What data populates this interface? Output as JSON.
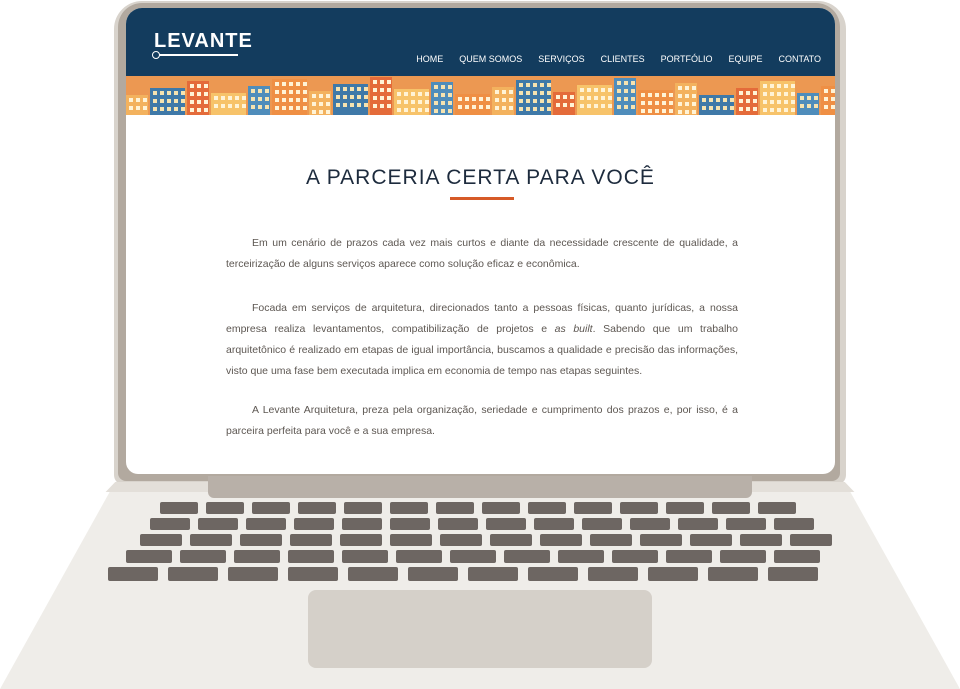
{
  "site": {
    "logo_text": "LEVANTE",
    "nav": [
      "HOME",
      "QUEM SOMOS",
      "SERVIÇOS",
      "CLIENTES",
      "PORTFÓLIO",
      "EQUIPE",
      "CONTATO"
    ]
  },
  "content": {
    "title": "A PARCERIA CERTA PARA VOCÊ",
    "p1": "Em um cenário de prazos cada vez mais curtos e diante da necessidade crescente de qualidade, a terceirização de alguns serviços aparece como solução eficaz e econômica.",
    "p2_part1": "Focada em serviços de arquitetura, direcionados tanto a pessoas físicas, quanto jurídicas, a nossa empresa realiza levantamentos, compatibilização de projetos e ",
    "p2_italic": "as built",
    "p2_part2": ". Sabendo que um trabalho arquitetônico é realizado em etapas de igual importância, buscamos a qualidade e precisão das informações, visto que uma fase bem executada implica em economia de tempo nas etapas seguintes.",
    "p3": "A Levante Arquitetura, preza pela organização, seriedade e cumprimento dos prazos e, por isso, é a parceira perfeita para você e a sua empresa."
  },
  "colors": {
    "header": "#133c5e",
    "accent": "#d65a27",
    "banner_orange": "#ec9852",
    "banner_blue": "#3f79a8",
    "text": "#5d5752"
  }
}
